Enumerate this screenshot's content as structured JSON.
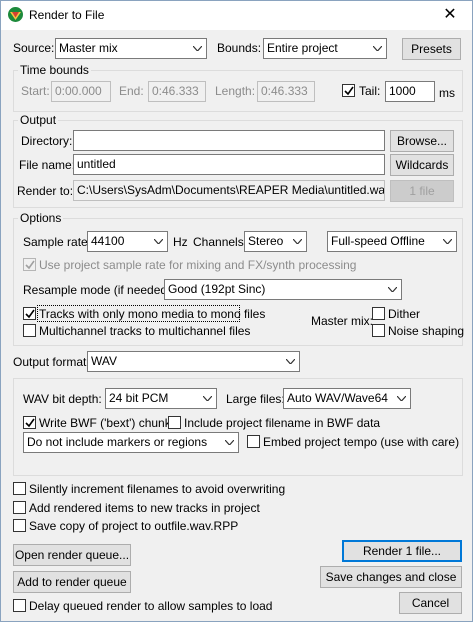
{
  "window": {
    "title": "Render to File",
    "close_glyph": "✕"
  },
  "top": {
    "source_label": "Source:",
    "source_value": "Master mix",
    "bounds_label": "Bounds:",
    "bounds_value": "Entire project",
    "presets_button": "Presets"
  },
  "time_bounds": {
    "title": "Time bounds",
    "start_label": "Start:",
    "start_value": "0:00.000",
    "end_label": "End:",
    "end_value": "0:46.333",
    "length_label": "Length:",
    "length_value": "0:46.333",
    "tail_label": "Tail:",
    "tail_checked": true,
    "tail_value": "1000",
    "tail_unit": "ms"
  },
  "output": {
    "title": "Output",
    "directory_label": "Directory:",
    "directory_value": "",
    "browse_button": "Browse...",
    "filename_label": "File name:",
    "filename_value": "untitled",
    "wildcards_button": "Wildcards",
    "renderto_label": "Render to:",
    "renderto_value": "C:\\Users\\SysAdm\\Documents\\REAPER Media\\untitled.wav",
    "files_button": "1 file"
  },
  "options": {
    "title": "Options",
    "samplerate_label": "Sample rate:",
    "samplerate_value": "44100",
    "samplerate_unit": "Hz",
    "channels_label": "Channels:",
    "channels_value": "Stereo",
    "speed_value": "Full-speed Offline",
    "use_project_rate_label": "Use project sample rate for mixing and FX/synth processing",
    "resample_label": "Resample mode (if needed):",
    "resample_value": "Good (192pt Sinc)",
    "mono_label": "Tracks with only mono media to mono files",
    "mono_checked": true,
    "multichannel_label": "Multichannel tracks to multichannel files",
    "multichannel_checked": false,
    "mastermix_label": "Master mix:",
    "dither_label": "Dither",
    "dither_checked": false,
    "noise_label": "Noise shaping",
    "noise_checked": false
  },
  "format": {
    "output_format_label": "Output format:",
    "output_format_value": "WAV",
    "bitdepth_label": "WAV bit depth:",
    "bitdepth_value": "24 bit PCM",
    "largefiles_label": "Large files:",
    "largefiles_value": "Auto WAV/Wave64",
    "bwf_label": "Write BWF ('bext') chunk",
    "bwf_checked": true,
    "include_filename_label": "Include project filename in BWF data",
    "include_filename_checked": false,
    "markers_value": "Do not include markers or regions",
    "embed_tempo_label": "Embed project tempo (use with care)",
    "embed_tempo_checked": false
  },
  "bottom": {
    "silently_label": "Silently increment filenames to avoid overwriting",
    "add_items_label": "Add rendered items to new tracks in project",
    "save_copy_label": "Save copy of project to outfile.wav.RPP",
    "open_queue_button": "Open render queue...",
    "add_queue_button": "Add to render queue",
    "delay_label": "Delay queued render to allow samples to load",
    "render_button": "Render 1 file...",
    "save_close_button": "Save changes and close",
    "cancel_button": "Cancel"
  }
}
